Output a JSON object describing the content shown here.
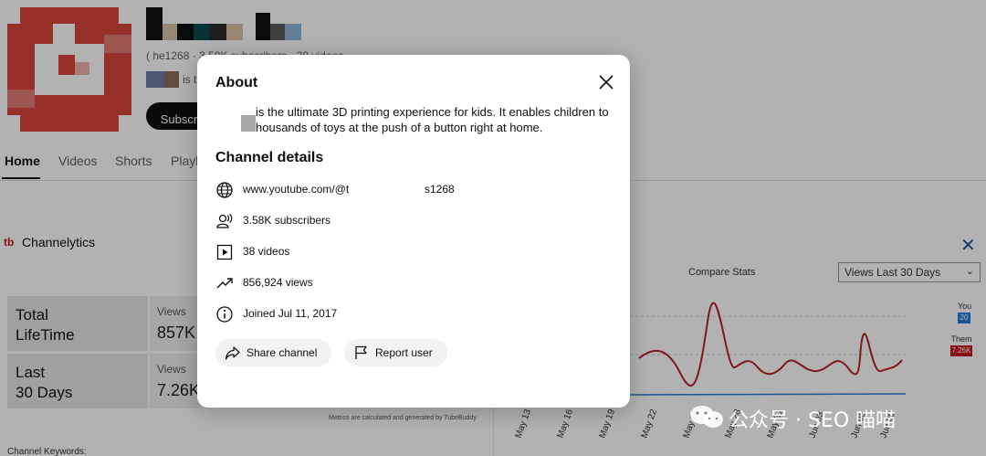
{
  "channel": {
    "meta_text": "(          he1268 · 3.58K subscribers · 38 videos",
    "desc_fragment": "is t",
    "subscribe_label": "Subscrib"
  },
  "tabs": [
    "Home",
    "Videos",
    "Shorts",
    "Playl"
  ],
  "channelytics": {
    "logo": "tb",
    "title": "Channelytics",
    "close_glyph": "✕",
    "compare_label": "Compare Stats",
    "select_value": "Views Last 30 Days",
    "stats": [
      {
        "label_line1": "Total",
        "label_line2": "LifeTime",
        "small": "Views",
        "value": "857K"
      },
      {
        "label_line1": "Last",
        "label_line2": "30 Days",
        "small": "Views",
        "value": "7.26K"
      }
    ],
    "legend_you_label": "You",
    "legend_you_value": "20",
    "legend_them_label": "Them",
    "legend_them_value": "7.26K",
    "metrics_note": "Metrics are calculated and generated by TubeBuddy",
    "keywords_label": "Channel Keywords:",
    "x_labels": [
      "May 13",
      "May 16",
      "May 19",
      "May 22",
      "May 25",
      "May 28",
      "May 31",
      "Jun 03",
      "Jun 06",
      "Jun 09"
    ]
  },
  "dialog": {
    "title": "About",
    "description_line1": "is the ultimate 3D printing experience for kids. It enables children to",
    "description_line2": "housands of toys at the push of a button right at home.",
    "details_title": "Channel details",
    "url_prefix": "www.youtube.com/@t",
    "url_suffix": "s1268",
    "subscribers": "3.58K subscribers",
    "videos": "38 videos",
    "views": "856,924 views",
    "joined": "Joined Jul 11, 2017",
    "share_label": "Share channel",
    "report_label": "Report user"
  },
  "icons": {
    "close": "close-icon",
    "globe": "globe-icon",
    "subscribers": "person-icon",
    "videos": "play-box-icon",
    "views": "trending-icon",
    "info": "info-icon",
    "share": "share-icon",
    "report": "flag-icon"
  },
  "watermark_text": "公众号 · SEO 喵喵",
  "colors": {
    "accent_red": "#c8161d",
    "accent_blue": "#2a7ad5",
    "dialog_bg": "#ffffff",
    "pill_bg": "#f2f2f2"
  }
}
